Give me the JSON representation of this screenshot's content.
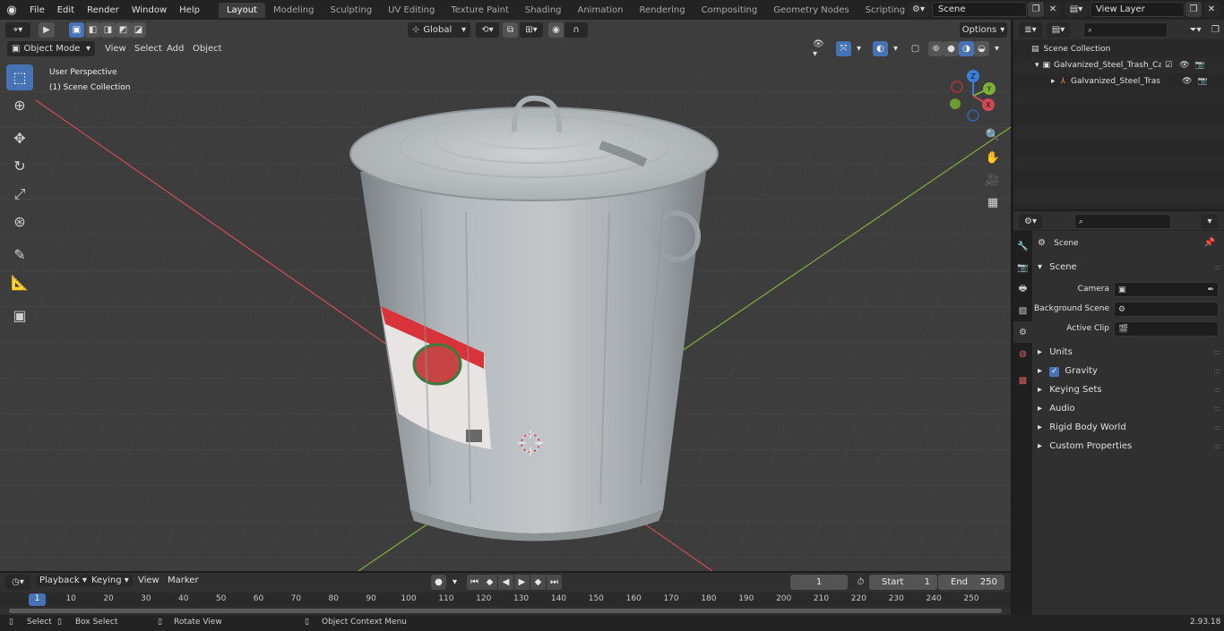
{
  "menubar": {
    "items": [
      "File",
      "Edit",
      "Render",
      "Window",
      "Help"
    ]
  },
  "workspaces": {
    "tabs": [
      "Layout",
      "Modeling",
      "Sculpting",
      "UV Editing",
      "Texture Paint",
      "Shading",
      "Animation",
      "Rendering",
      "Compositing",
      "Geometry Nodes",
      "Scripting"
    ],
    "active": "Layout",
    "add_label": "+"
  },
  "scene_selector": {
    "value": "Scene"
  },
  "view_layer_selector": {
    "value": "View Layer"
  },
  "viewport": {
    "mode_label": "Object Mode",
    "menus": [
      "View",
      "Select",
      "Add",
      "Object"
    ],
    "orientation_label": "Global",
    "options_label": "Options",
    "overlay_line1": "User Perspective",
    "overlay_line2": "(1) Scene Collection",
    "gizmo": {
      "x": "X",
      "y": "Y",
      "z": "Z"
    }
  },
  "outliner": {
    "rows": [
      {
        "label": "Scene Collection",
        "indent": 0
      },
      {
        "label": "Galvanized_Steel_Trash_Can_",
        "indent": 1
      },
      {
        "label": "Galvanized_Steel_Trash_",
        "indent": 2
      }
    ]
  },
  "properties": {
    "context_label": "Scene",
    "section_title": "Scene",
    "fields": [
      {
        "label": "Camera",
        "value": ""
      },
      {
        "label": "Background Scene",
        "value": ""
      },
      {
        "label": "Active Clip",
        "value": ""
      }
    ],
    "panels": [
      "Units",
      "Gravity",
      "Keying Sets",
      "Audio",
      "Rigid Body World",
      "Custom Properties"
    ],
    "gravity_enabled": true
  },
  "timeline": {
    "menus": [
      "Playback",
      "Keying",
      "View",
      "Marker"
    ],
    "current_frame": "1",
    "start_label": "Start",
    "start_value": "1",
    "end_label": "End",
    "end_value": "250",
    "ruler_ticks": [
      "1",
      "10",
      "20",
      "30",
      "40",
      "50",
      "60",
      "70",
      "80",
      "90",
      "100",
      "110",
      "120",
      "130",
      "140",
      "150",
      "160",
      "170",
      "180",
      "190",
      "200",
      "210",
      "220",
      "230",
      "240",
      "250"
    ]
  },
  "statusbar": {
    "select_label": "Select",
    "box_select_label": "Box Select",
    "rotate_view_label": "Rotate View",
    "context_menu_label": "Object Context Menu",
    "version": "2.93.18"
  },
  "colors": {
    "accent": "#4772b3",
    "x_axis": "#d04a55",
    "y_axis": "#7fb03a",
    "z_axis": "#3a7fd8"
  }
}
